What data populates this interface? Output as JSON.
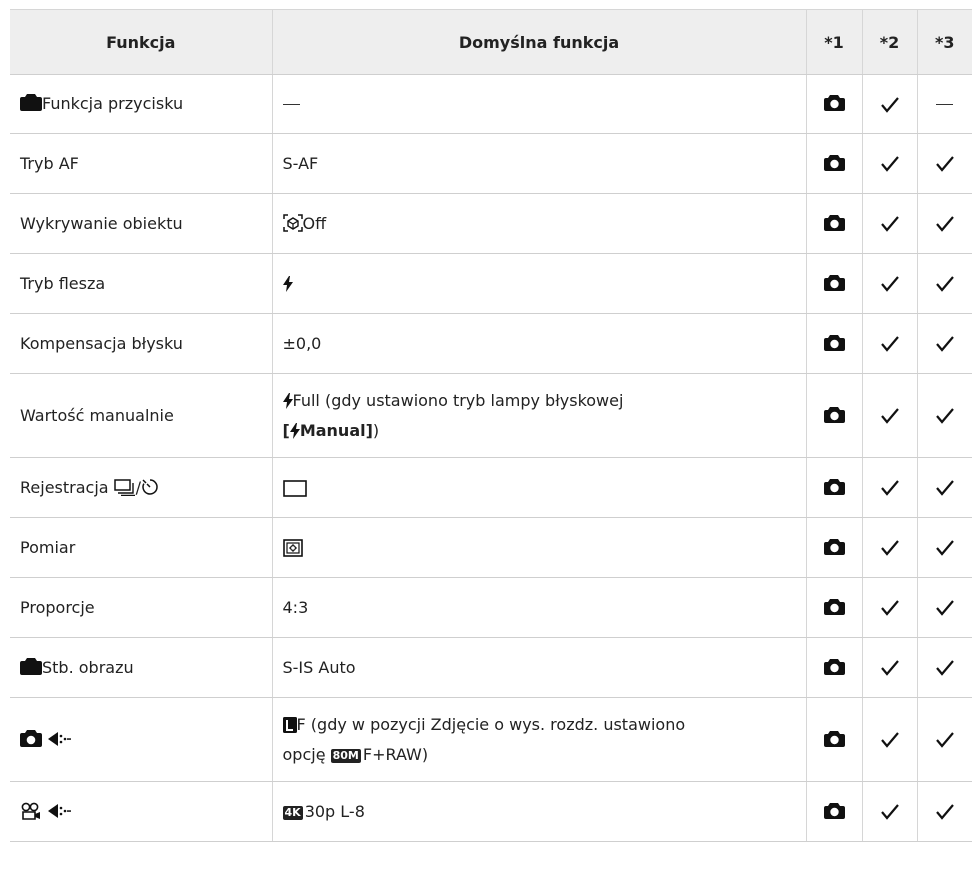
{
  "header": {
    "col1": "Funkcja",
    "col2": "Domyślna funkcja",
    "col3": "*1",
    "col4": "*2",
    "col5": "*3"
  },
  "rows": [
    {
      "func": "Funkcja przycisku",
      "default": "—",
      "m3": "—"
    },
    {
      "func": "Tryb AF",
      "default": "S-AF"
    },
    {
      "func": "Wykrywanie obiektu",
      "default": "Off"
    },
    {
      "func": "Tryb flesza",
      "default": ""
    },
    {
      "func": "Kompensacja błysku",
      "default": "±0,0"
    },
    {
      "func": "Wartość manualnie",
      "default_line1": "Full (gdy ustawiono tryb lampy błyskowej",
      "default_line2_bold": "Manual]",
      "default_line2_close": ")"
    },
    {
      "func": "Rejestracja",
      "func_sep": "/",
      "default": ""
    },
    {
      "func": "Pomiar",
      "default": ""
    },
    {
      "func": "Proporcje",
      "default": "4:3"
    },
    {
      "func": "Stb. obrazu",
      "default": "S-IS Auto"
    },
    {
      "func": "",
      "default_line1": "F (gdy w pozycji Zdjęcie o wys. rozdz. ustawiono",
      "default_line2": "opcję",
      "badge": "80M",
      "default_line2_after": "F+RAW)"
    },
    {
      "func": "",
      "badge": "4K",
      "default": "30p L-8"
    }
  ],
  "icons": {
    "camera": "camera-icon",
    "check": "check-icon",
    "flash": "flash-icon",
    "movie": "movie-icon",
    "quality": "image-quality-icon"
  }
}
